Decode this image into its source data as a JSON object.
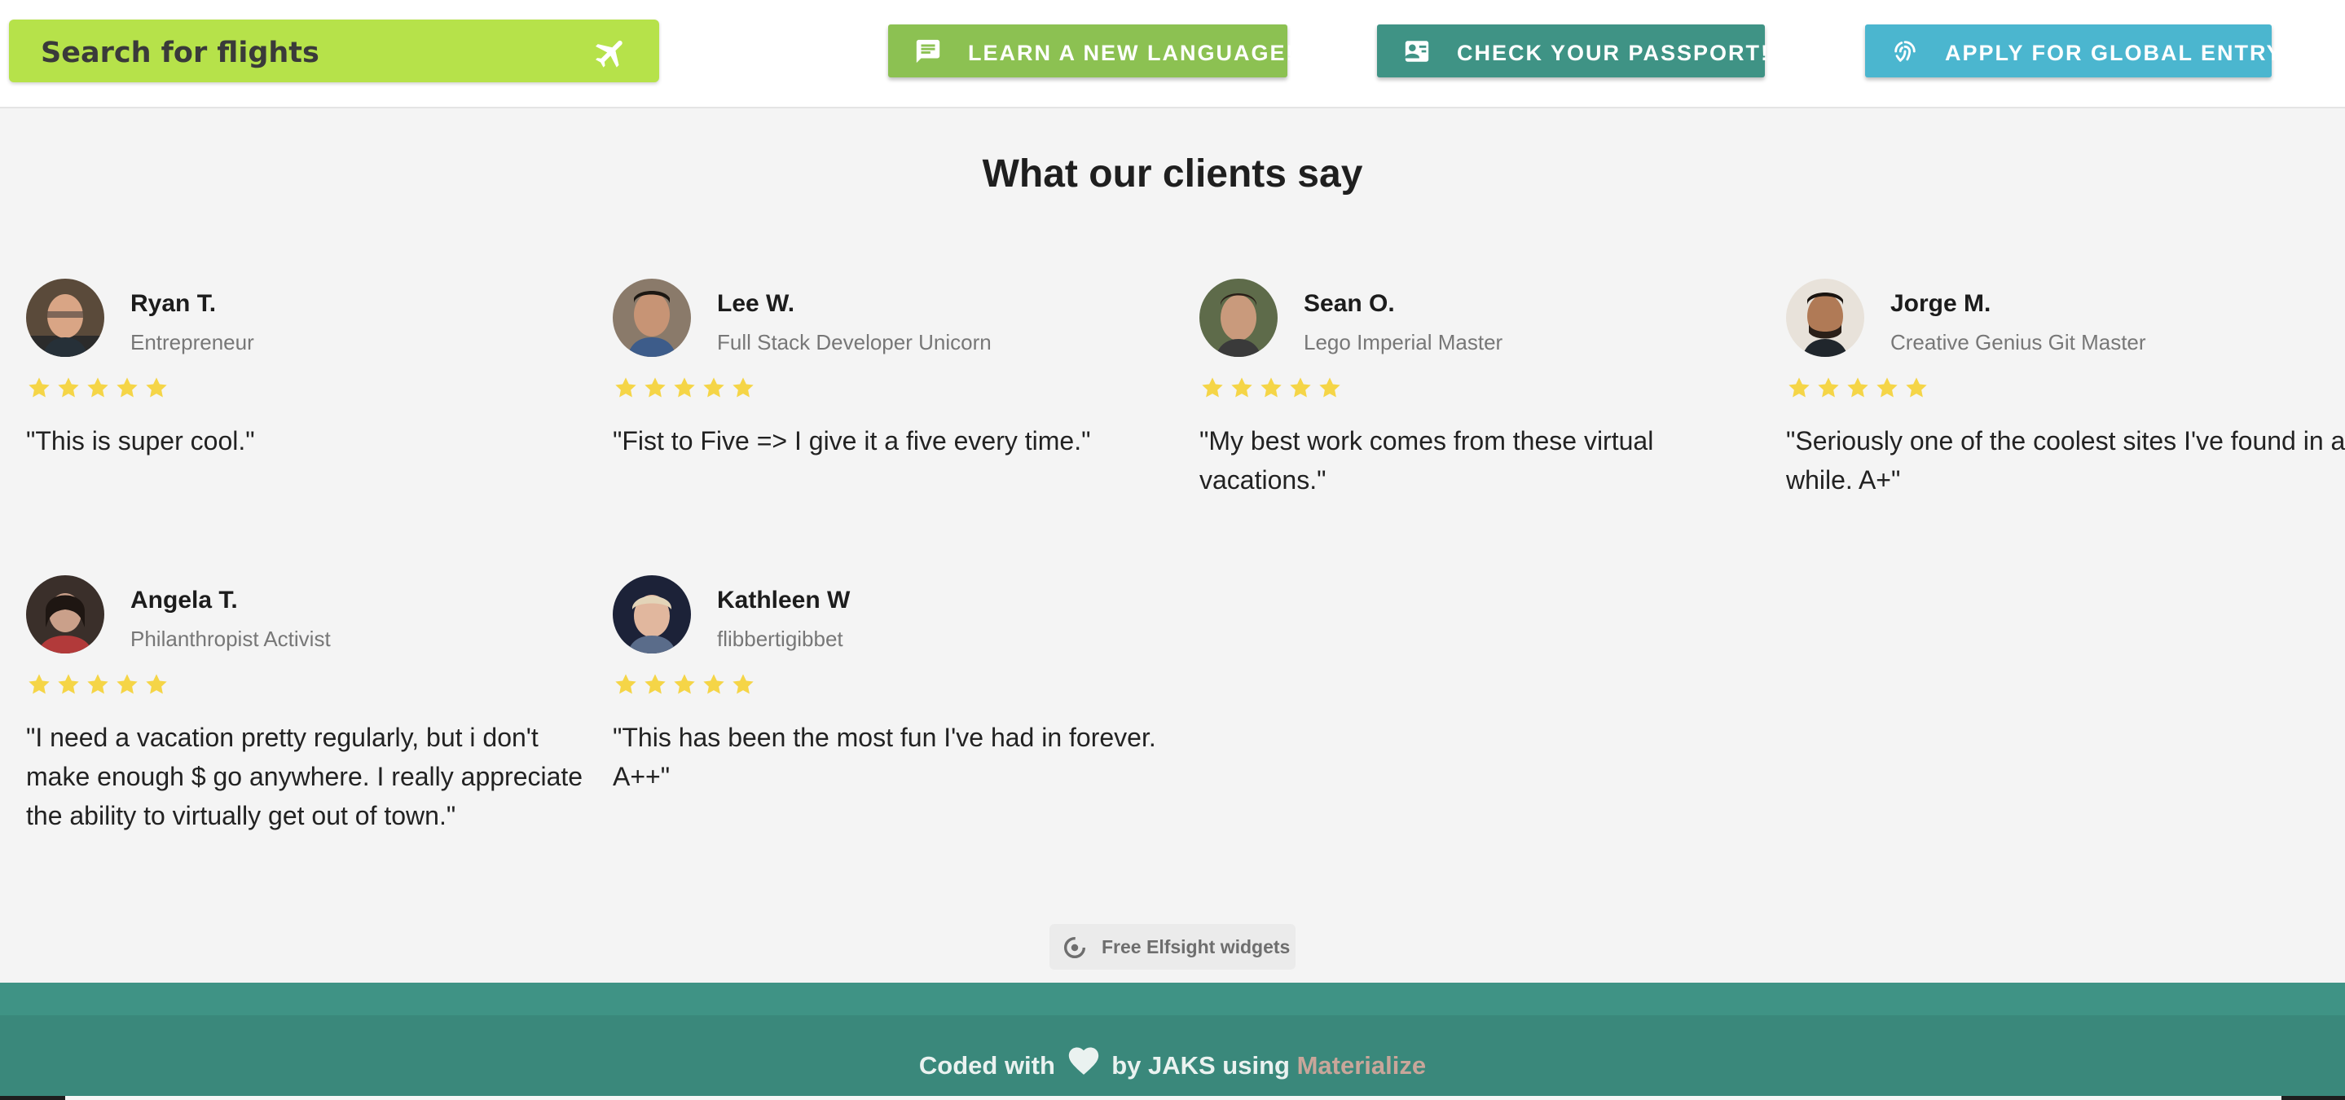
{
  "header": {
    "search_label": "Search for flights",
    "buttons": [
      {
        "label": "LEARN A NEW LANGUAGE!",
        "icon": "chat-icon",
        "color": "#8cc152"
      },
      {
        "label": "CHECK YOUR PASSPORT!",
        "icon": "id-card-icon",
        "color": "#3f9385"
      },
      {
        "label": "APPLY FOR GLOBAL ENTRY",
        "icon": "fingerprint-icon",
        "color": "#4bb6cf"
      }
    ]
  },
  "testimonials": {
    "title": "What our clients say",
    "star_color": "#f5d547",
    "items": [
      {
        "name": "Ryan T.",
        "role": "Entrepreneur",
        "rating": 5,
        "quote": "\"This is super cool.\""
      },
      {
        "name": "Lee W.",
        "role": "Full Stack Developer Unicorn",
        "rating": 5,
        "quote": "\"Fist to Five => I give it a five every time.\""
      },
      {
        "name": "Sean O.",
        "role": "Lego Imperial Master",
        "rating": 5,
        "quote": "\"My best work comes from these virtual vacations.\""
      },
      {
        "name": "Jorge M.",
        "role": "Creative Genius Git Master",
        "rating": 5,
        "quote": "\"Seriously one of the coolest sites I've found in a while.  A+\""
      },
      {
        "name": "Angela T.",
        "role": "Philanthropist Activist",
        "rating": 5,
        "quote": "\"I need a vacation pretty regularly, but i don't make enough $ go anywhere.  I really appreciate the ability to virtually get out of town.\""
      },
      {
        "name": "Kathleen W",
        "role": "flibbertigibbet",
        "rating": 5,
        "quote": "\"This has been the most fun I've had in forever.  A++\""
      }
    ],
    "widget_label": "Free Elfsight widgets"
  },
  "footer": {
    "prefix": "Coded with",
    "middle": "by JAKS using",
    "link": "Materialize",
    "accent": "#3f9385"
  }
}
